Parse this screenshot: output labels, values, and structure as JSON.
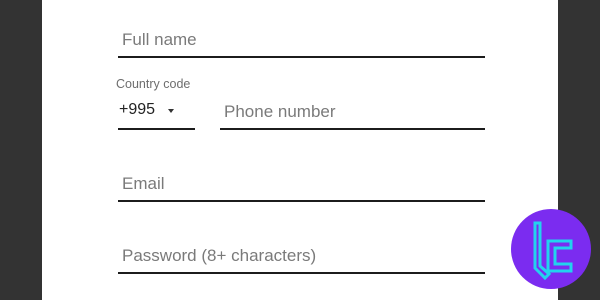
{
  "form": {
    "full_name": {
      "value": "",
      "placeholder": "Full name"
    },
    "country_code": {
      "label": "Country code",
      "selected": "+995"
    },
    "phone": {
      "value": "",
      "placeholder": "Phone number"
    },
    "email": {
      "value": "",
      "placeholder": "Email"
    },
    "password": {
      "value": "",
      "placeholder": "Password (8+ characters)"
    }
  },
  "logo": {
    "icon": "brand-logo-icon",
    "colors": {
      "circle": "#7b2cf0",
      "glyph": "#22d3ee"
    }
  },
  "colors": {
    "background": "#2e2e2e",
    "card": "#ffffff",
    "underline": "#1c1c1c",
    "placeholder": "#7a7a7a"
  }
}
